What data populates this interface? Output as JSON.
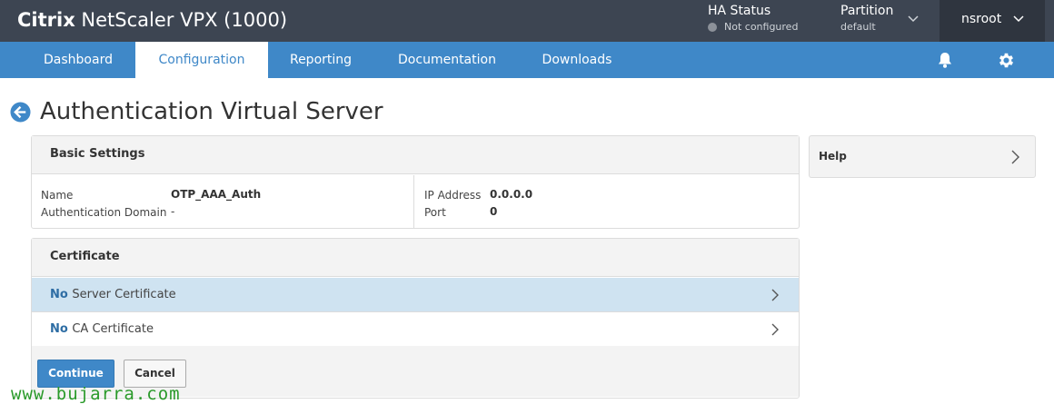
{
  "header": {
    "brand_bold": "Citrix",
    "brand_rest": " NetScaler VPX (1000)",
    "ha_status_label": "HA Status",
    "ha_status_value": "Not configured",
    "partition_label": "Partition",
    "partition_value": "default",
    "user": "nsroot"
  },
  "nav": {
    "tabs": [
      {
        "label": "Dashboard"
      },
      {
        "label": "Configuration"
      },
      {
        "label": "Reporting"
      },
      {
        "label": "Documentation"
      },
      {
        "label": "Downloads"
      }
    ],
    "active_tab": "Configuration"
  },
  "page": {
    "title": "Authentication Virtual Server"
  },
  "basic_settings": {
    "heading": "Basic Settings",
    "name_label": "Name",
    "name_value": "OTP_AAA_Auth",
    "auth_domain_label": "Authentication Domain",
    "auth_domain_value": "-",
    "ip_label": "IP Address",
    "ip_value": "0.0.0.0",
    "port_label": "Port",
    "port_value": "0"
  },
  "certificate": {
    "heading": "Certificate",
    "rows": [
      {
        "prefix": "No",
        "label": "Server Certificate"
      },
      {
        "prefix": "No",
        "label": "CA Certificate"
      }
    ],
    "continue_label": "Continue",
    "cancel_label": "Cancel"
  },
  "help": {
    "label": "Help"
  },
  "watermark": "www.bujarra.com",
  "colors": {
    "topbar": "#3d4552",
    "nav": "#3f88c8",
    "selected_row": "#cfe3f1",
    "watermark": "#2a9a2a"
  }
}
